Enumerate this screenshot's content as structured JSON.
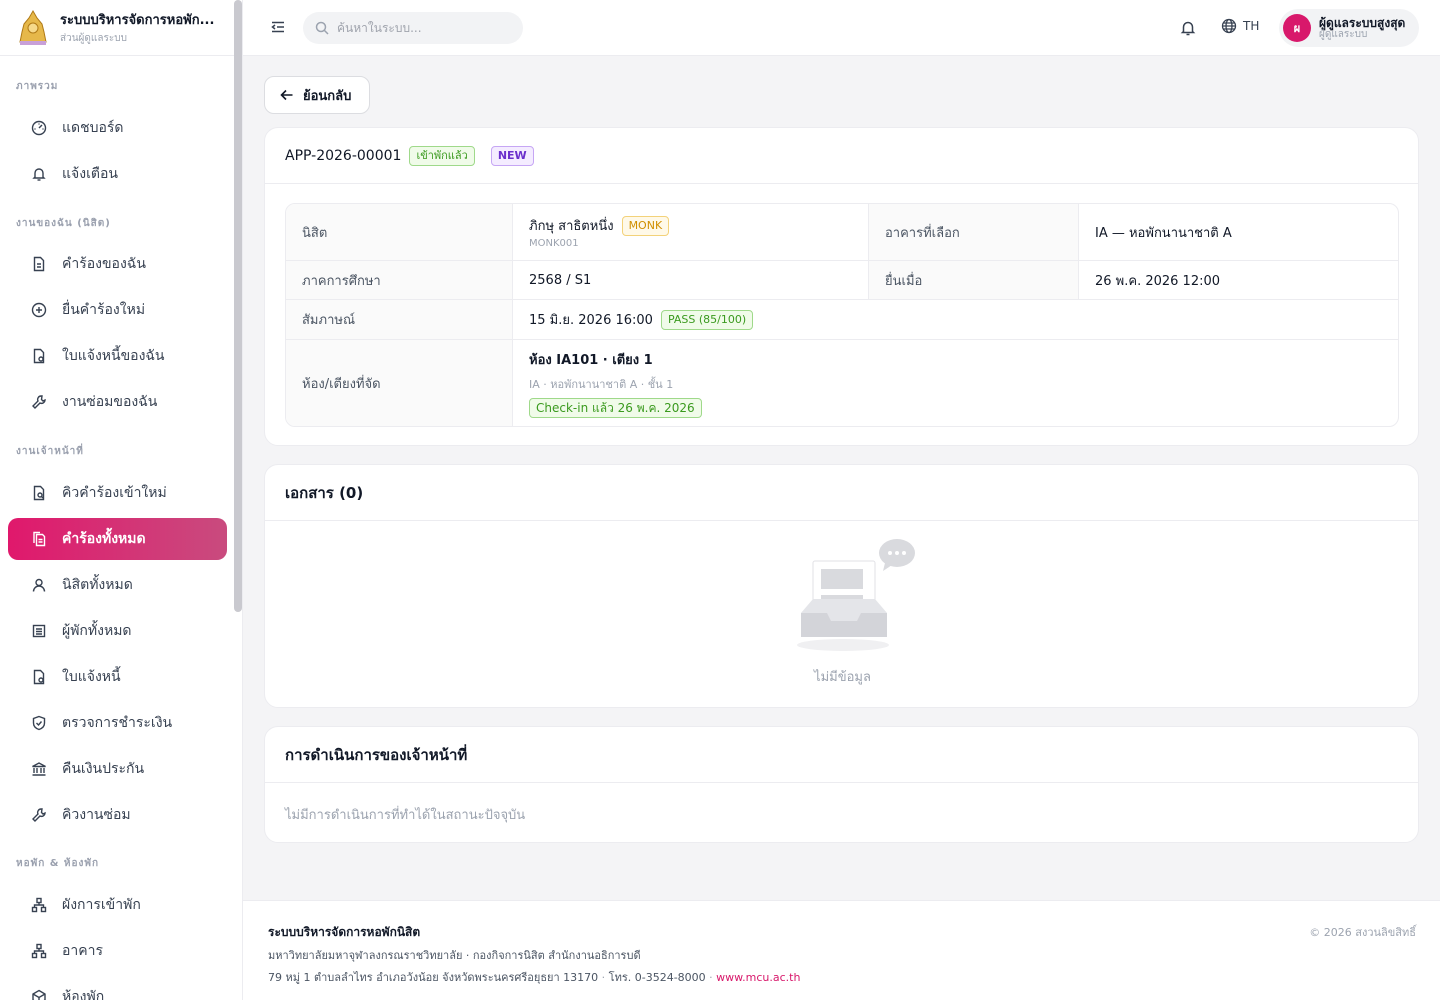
{
  "brand": {
    "title": "ระบบบริหารจัดการหอพัก...",
    "subtitle": "ส่วนผู้ดูแลระบบ"
  },
  "sidebar": {
    "sections": [
      {
        "label": "ภาพรวม"
      },
      {
        "label": "งานของฉัน (นิสิต)"
      },
      {
        "label": "งานเจ้าหน้าที่"
      },
      {
        "label": "หอพัก & ห้องพัก"
      }
    ],
    "items": [
      {
        "label": "แดชบอร์ด",
        "icon": "dashboard-icon"
      },
      {
        "label": "แจ้งเตือน",
        "icon": "bell-icon"
      },
      {
        "label": "คำร้องของฉัน",
        "icon": "document-icon"
      },
      {
        "label": "ยื่นคำร้องใหม่",
        "icon": "plus-circle-icon"
      },
      {
        "label": "ใบแจ้งหนี้ของฉัน",
        "icon": "invoice-icon"
      },
      {
        "label": "งานซ่อมของฉัน",
        "icon": "wrench-icon"
      },
      {
        "label": "คิวคำร้องเข้าใหม่",
        "icon": "queue-document-icon"
      },
      {
        "label": "คำร้องทั้งหมด",
        "icon": "copy-document-icon",
        "active": true
      },
      {
        "label": "นิสิตทั้งหมด",
        "icon": "user-icon"
      },
      {
        "label": "ผู้พักทั้งหมด",
        "icon": "list-icon"
      },
      {
        "label": "ใบแจ้งหนี้",
        "icon": "invoice-icon"
      },
      {
        "label": "ตรวจการชำระเงิน",
        "icon": "shield-check-icon"
      },
      {
        "label": "คืนเงินประกัน",
        "icon": "bank-icon"
      },
      {
        "label": "คิวงานซ่อม",
        "icon": "wrench-icon"
      },
      {
        "label": "ผังการเข้าพัก",
        "icon": "org-chart-icon"
      },
      {
        "label": "อาคาร",
        "icon": "org-chart-icon"
      },
      {
        "label": "ห้องพัก",
        "icon": "cube-icon"
      }
    ]
  },
  "topbar": {
    "search_placeholder": "ค้นหาในระบบ...",
    "lang": "TH",
    "user": {
      "initial": "ผ",
      "name": "ผู้ดูแลระบบสูงสุด",
      "role": "ผู้ดูแลระบบ"
    }
  },
  "back_label": "ย้อนกลับ",
  "application": {
    "number": "APP-2026-00001",
    "status": "เข้าพักแล้ว",
    "flag": "NEW",
    "fields": {
      "student_label": "นิสิต",
      "student_name": "ภิกษุ สาธิตหนึ่ง",
      "student_type": "MONK",
      "student_id": "MONK001",
      "building_label": "อาคารที่เลือก",
      "building_value": "IA — หอพักนานาชาติ A",
      "term_label": "ภาคการศึกษา",
      "term_value": "2568 / S1",
      "submitted_label": "ยื่นเมื่อ",
      "submitted_value": "26 พ.ค. 2026 12:00",
      "interview_label": "สัมภาษณ์",
      "interview_value": "15 มิ.ย. 2026 16:00",
      "interview_result": "PASS (85/100)",
      "room_label": "ห้อง/เตียงที่จัด",
      "room_value": "ห้อง IA101 · เตียง 1",
      "room_detail": "IA · หอพักนานาชาติ A · ชั้น 1",
      "checkin": "Check-in แล้ว 26 พ.ค. 2026"
    }
  },
  "documents": {
    "title": "เอกสาร (0)",
    "empty": "ไม่มีข้อมูล"
  },
  "actions": {
    "title": "การดำเนินการของเจ้าหน้าที่",
    "empty": "ไม่มีการดำเนินการที่ทำได้ในสถานะปัจจุบัน"
  },
  "footer": {
    "title": "ระบบบริหารจัดการหอพักนิสิต",
    "org": "มหาวิทยาลัยมหาจุฬาลงกรณราชวิทยาลัย · กองกิจการนิสิต สำนักงานอธิการบดี",
    "address": "79 หมู่ 1 ตำบลลำไทร อำเภอวังน้อย จังหวัดพระนครศรีอยุธยา 13170",
    "phone": "โทร. 0-3524-8000",
    "website": "www.mcu.ac.th",
    "copyright": "© 2026 สงวนลิขสิทธิ์"
  },
  "colors": {
    "accent": "#d8186b",
    "success": "#3a9a1e",
    "purple": "#6b2fcc",
    "gold": "#d08f00"
  }
}
